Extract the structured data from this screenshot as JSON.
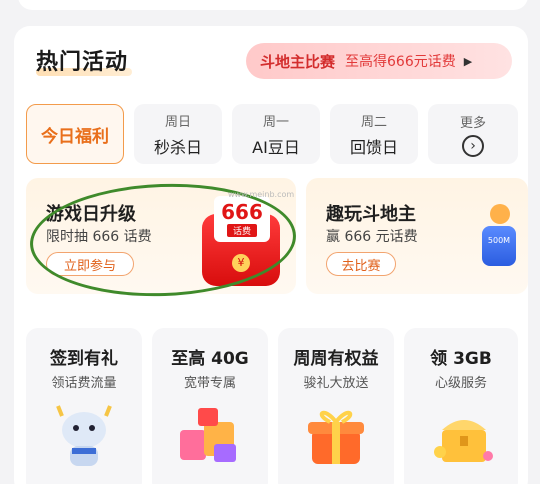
{
  "section": {
    "title": "热门活动"
  },
  "promo": {
    "title": "斗地主比赛",
    "subtitle": "至高得666元话费",
    "arrow": "▶"
  },
  "tabs": [
    {
      "top": "",
      "bottom": "今日福利",
      "active": true
    },
    {
      "top": "周日",
      "bottom": "秒杀日"
    },
    {
      "top": "周一",
      "bottom": "AI豆日"
    },
    {
      "top": "周二",
      "bottom": "回馈日"
    },
    {
      "top": "更多",
      "bottom": ""
    }
  ],
  "promo_cards": [
    {
      "title": "游戏日升级",
      "subtitle": "限时抽 666 话费",
      "button": "立即参与",
      "badge_num": "666",
      "badge_label": "话费",
      "coin": "¥"
    },
    {
      "title": "趣玩斗地主",
      "subtitle": "赢 666 元话费",
      "button": "去比赛",
      "deco_text": "500M"
    }
  ],
  "features": [
    {
      "title": "签到有礼",
      "subtitle": "领话费流量",
      "icon": "mascot-icon"
    },
    {
      "title": "至高 40G",
      "subtitle": "宽带专属",
      "icon": "gift-cubes-icon"
    },
    {
      "title": "周周有权益",
      "subtitle": "骏礼大放送",
      "icon": "gift-box-icon"
    },
    {
      "title": "领 3GB",
      "subtitle": "心级服务",
      "icon": "treasure-chest-icon"
    }
  ],
  "watermark": "www.meinb.com",
  "colors": {
    "accent": "#e96f1b",
    "promo_red": "#d32d2d",
    "circle_mark": "#3f8a2b"
  }
}
